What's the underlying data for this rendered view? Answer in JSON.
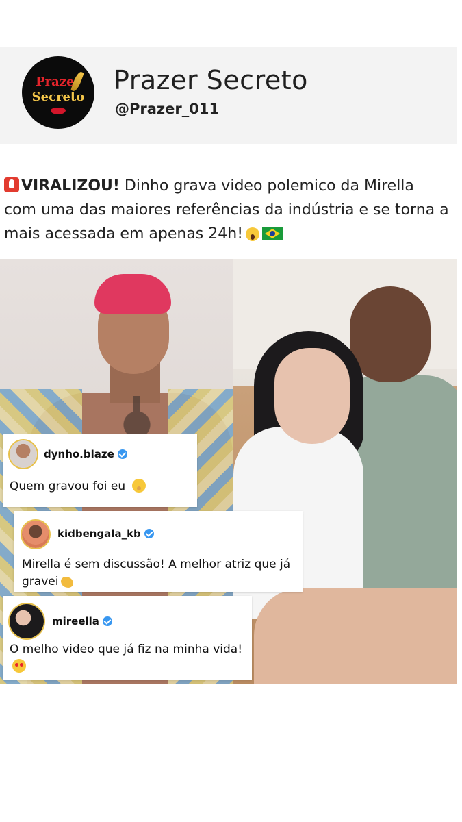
{
  "profile": {
    "logo_line1": "Prazer",
    "logo_line2": "Secreto",
    "name": "Prazer Secreto",
    "handle": "@Prazer_011"
  },
  "post": {
    "caption_bold": "VIRALIZOU!",
    "caption_text": " Dinho grava video polemico da Mirella com uma das maiores referências da indústria e se torna a mais acessada em apenas 24h!"
  },
  "comments": [
    {
      "username": "dynho.blaze",
      "verified": true,
      "text": "Quem gravou foi eu"
    },
    {
      "username": "kidbengala_kb",
      "verified": true,
      "text": "Mirella é sem discussão! A melhor atriz que já gravei"
    },
    {
      "username": "mireella",
      "verified": true,
      "text": "O melho video que já fiz na minha vida!"
    }
  ],
  "colors": {
    "header_bg": "#f3f3f3",
    "verified_blue": "#3897f0",
    "logo_red": "#e2242b",
    "logo_gold": "#f4c64a"
  },
  "icons": [
    "siren-icon",
    "scream-emoji-icon",
    "brazil-flag-icon",
    "verified-badge-icon",
    "shush-emoji-icon",
    "clap-emoji-icon",
    "heart-eyes-emoji-icon"
  ]
}
